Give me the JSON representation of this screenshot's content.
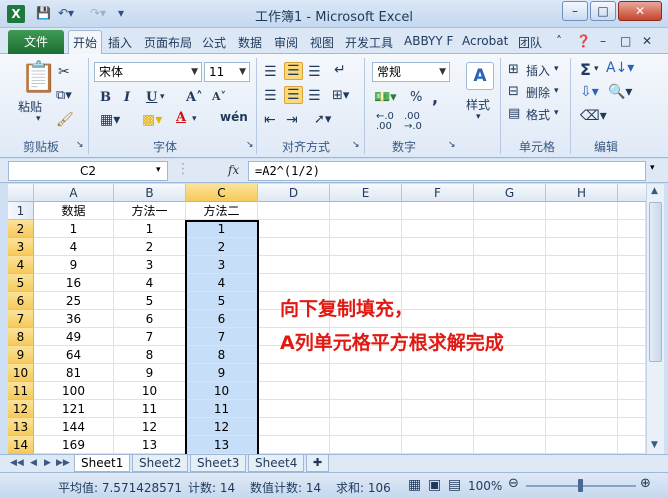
{
  "window": {
    "title": "工作簿1 - Microsoft Excel",
    "app_icon": "X"
  },
  "tabs": {
    "file": "文件",
    "items": [
      "开始",
      "插入",
      "页面布局",
      "公式",
      "数据",
      "审阅",
      "视图",
      "开发工具",
      "ABBYY F",
      "Acrobat",
      "团队"
    ],
    "active": "开始"
  },
  "ribbon": {
    "paste_label": "粘贴",
    "font_name": "宋体",
    "font_size": "11",
    "number_format": "常规",
    "style_label": "样式",
    "insert_label": "插入",
    "delete_label": "删除",
    "format_label": "格式",
    "groups": {
      "clipboard": "剪贴板",
      "font": "字体",
      "alignment": "对齐方式",
      "number": "数字",
      "cells": "单元格",
      "editing": "编辑"
    }
  },
  "formula_bar": {
    "name_box": "C2",
    "fx": "fx",
    "formula": "=A2^(1/2)"
  },
  "grid": {
    "columns": [
      "A",
      "B",
      "C",
      "D",
      "E",
      "F",
      "G",
      "H"
    ],
    "selected_column": "C",
    "rows": [
      {
        "n": "1",
        "a": "数据",
        "b": "方法一",
        "c": "方法二"
      },
      {
        "n": "2",
        "a": "1",
        "b": "1",
        "c": "1"
      },
      {
        "n": "3",
        "a": "4",
        "b": "2",
        "c": "2"
      },
      {
        "n": "4",
        "a": "9",
        "b": "3",
        "c": "3"
      },
      {
        "n": "5",
        "a": "16",
        "b": "4",
        "c": "4"
      },
      {
        "n": "6",
        "a": "25",
        "b": "5",
        "c": "5"
      },
      {
        "n": "7",
        "a": "36",
        "b": "6",
        "c": "6"
      },
      {
        "n": "8",
        "a": "49",
        "b": "7",
        "c": "7"
      },
      {
        "n": "9",
        "a": "64",
        "b": "8",
        "c": "8"
      },
      {
        "n": "10",
        "a": "81",
        "b": "9",
        "c": "9"
      },
      {
        "n": "11",
        "a": "100",
        "b": "10",
        "c": "10"
      },
      {
        "n": "12",
        "a": "121",
        "b": "11",
        "c": "11"
      },
      {
        "n": "13",
        "a": "144",
        "b": "12",
        "c": "12"
      },
      {
        "n": "14",
        "a": "169",
        "b": "13",
        "c": "13"
      }
    ],
    "annotation_line1": "向下复制填充，",
    "annotation_line2": "A列单元格平方根求解完成"
  },
  "sheets": {
    "tabs": [
      "Sheet1",
      "Sheet2",
      "Sheet3",
      "Sheet4"
    ],
    "active": "Sheet1"
  },
  "status": {
    "average": "平均值: 7.571428571",
    "count": "计数: 14",
    "numeric_count": "数值计数: 14",
    "sum": "求和: 106",
    "zoom": "100%"
  },
  "colors": {
    "accent_green": "#1e7a3c",
    "selection_fill": "#c6def7",
    "annotation_red": "#e01a12"
  }
}
